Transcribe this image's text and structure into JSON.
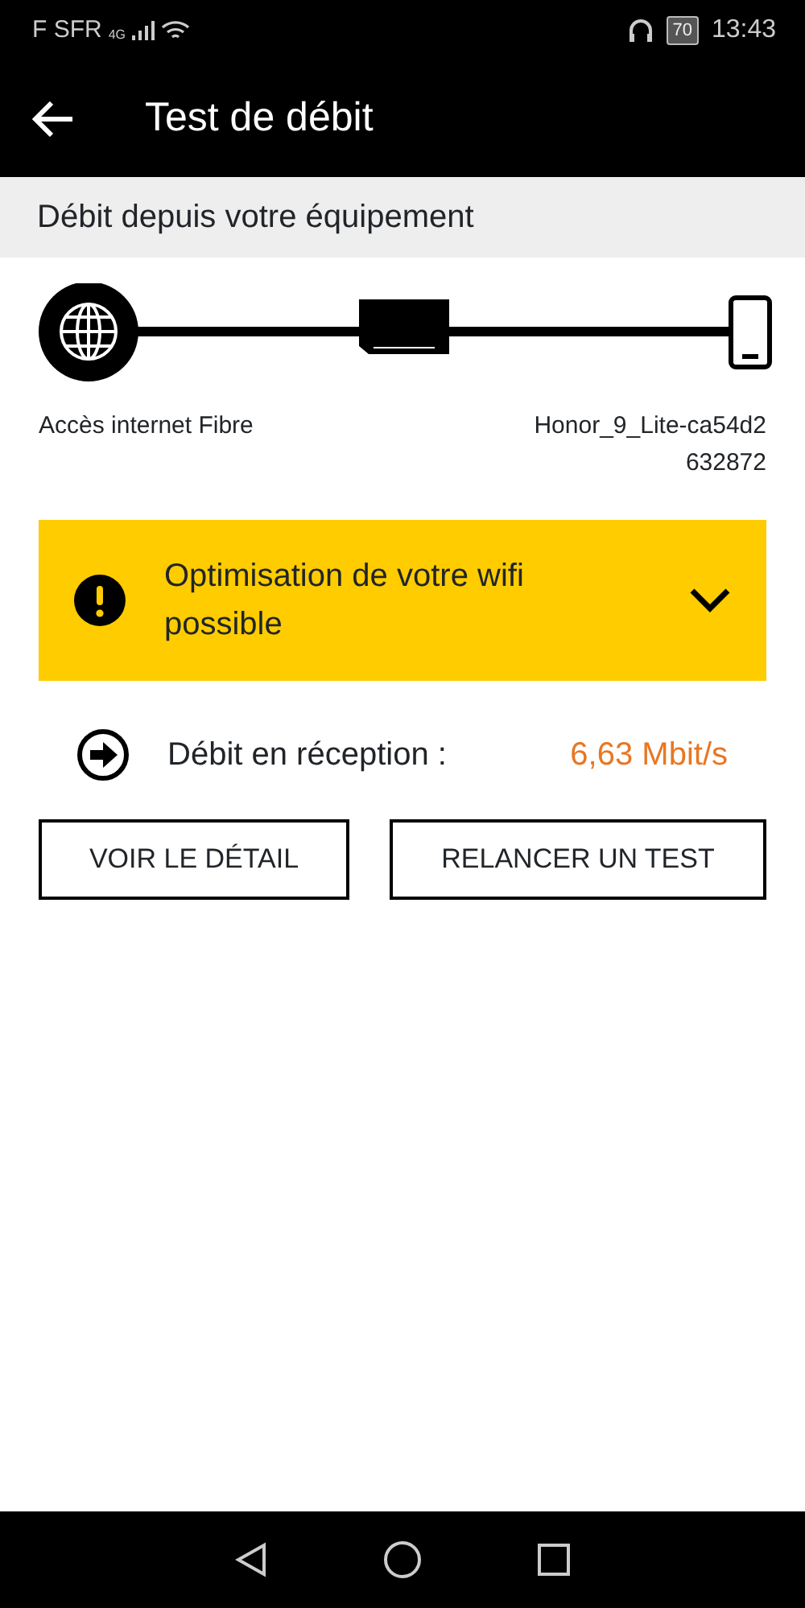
{
  "status_bar": {
    "carrier": "F SFR",
    "network": "4G",
    "battery": "70",
    "time": "13:43"
  },
  "app_bar": {
    "title": "Test de débit"
  },
  "section": {
    "title": "Débit depuis votre équipement"
  },
  "diagram": {
    "source_label": "Accès internet Fibre",
    "device_label": "Honor_9_Lite-ca54d2\n632872"
  },
  "alert": {
    "text": "Optimisation de votre wifi possible",
    "expanded": false
  },
  "result": {
    "label": "Débit en réception :",
    "value": "6,63 Mbit/s"
  },
  "buttons": [
    "VOIR LE DÉTAIL",
    "RELANCER UN TEST"
  ]
}
